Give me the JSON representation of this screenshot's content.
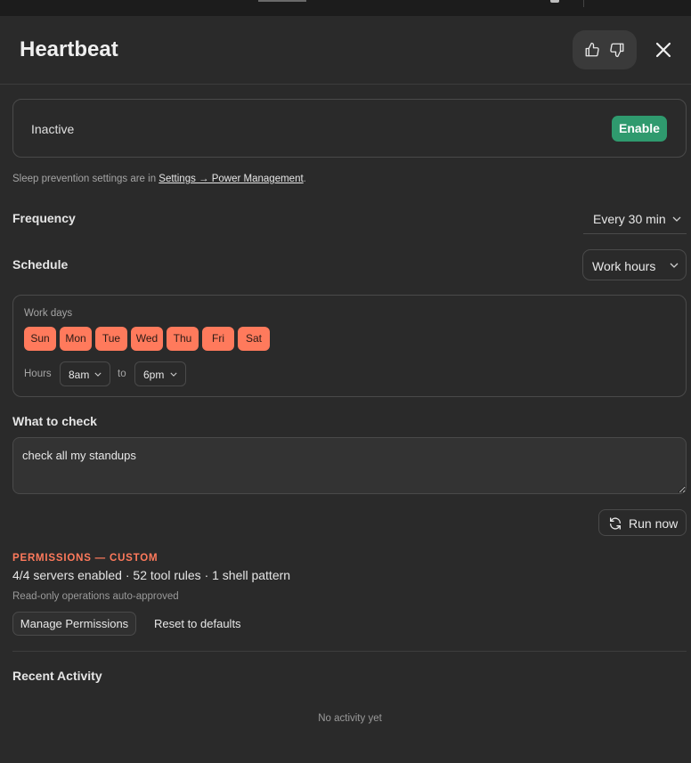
{
  "header": {
    "title": "Heartbeat"
  },
  "status": {
    "text": "Inactive",
    "enable_label": "Enable"
  },
  "note": {
    "prefix": "Sleep prevention settings are in ",
    "link": "Settings → Power Management",
    "suffix": "."
  },
  "frequency": {
    "label": "Frequency",
    "value": "Every 30 min"
  },
  "schedule": {
    "label": "Schedule",
    "value": "Work hours"
  },
  "workdays": {
    "label": "Work days",
    "days": [
      "Sun",
      "Mon",
      "Tue",
      "Wed",
      "Thu",
      "Fri",
      "Sat"
    ],
    "hours_label": "Hours",
    "from": "8am",
    "to_label": "to",
    "to": "6pm"
  },
  "check": {
    "label": "What to check",
    "value": "check all my standups"
  },
  "run_now": {
    "label": "Run now",
    "icon": "refresh-icon"
  },
  "permissions": {
    "title": "PERMISSIONS — CUSTOM",
    "summary": "4/4 servers enabled · 52 tool rules · 1 shell pattern",
    "note": "Read-only operations auto-approved",
    "manage_label": "Manage Permissions",
    "reset_label": "Reset to defaults"
  },
  "recent": {
    "title": "Recent Activity",
    "empty": "No activity yet"
  },
  "colors": {
    "accent": "#ff7a5c",
    "enable": "#2f9a6e",
    "background": "#2a2a2a"
  }
}
